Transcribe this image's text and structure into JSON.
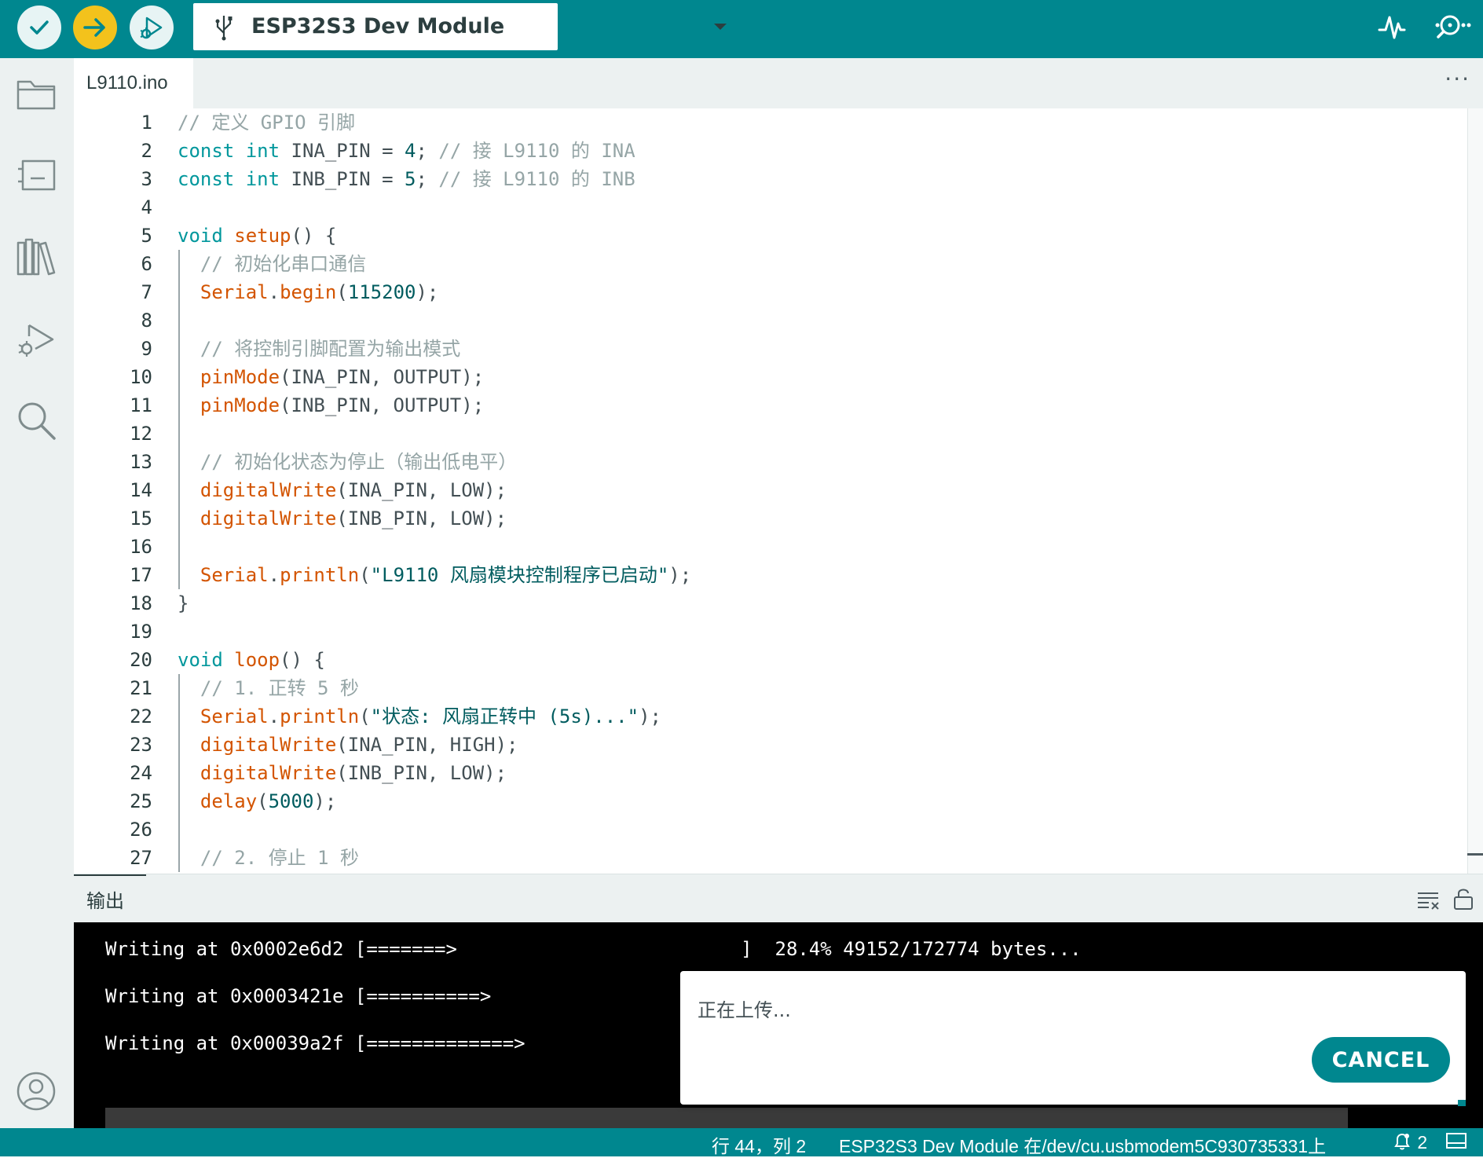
{
  "toolbar": {
    "verify_icon": "checkmark-icon",
    "upload_icon": "arrow-right-icon",
    "debug_icon": "debug-icon",
    "board_name": "ESP32S3 Dev Module",
    "serial_plotter_icon": "pulse-icon",
    "serial_monitor_icon": "magnifier-dots-icon"
  },
  "sidebar": {
    "items": [
      {
        "name": "sketchbook",
        "icon": "folder-icon"
      },
      {
        "name": "boards-manager",
        "icon": "board-icon"
      },
      {
        "name": "library-manager",
        "icon": "library-icon"
      },
      {
        "name": "debug",
        "icon": "debug-icon"
      },
      {
        "name": "search",
        "icon": "search-icon"
      },
      {
        "name": "profile",
        "icon": "user-icon"
      }
    ]
  },
  "tabs": [
    {
      "label": "L9110.ino",
      "active": true
    }
  ],
  "tab_more": "···",
  "editor": {
    "lines": [
      {
        "n": "1",
        "tokens": [
          {
            "t": "// 定义 GPIO 引脚",
            "c": "com"
          }
        ]
      },
      {
        "n": "2",
        "tokens": [
          {
            "t": "const",
            "c": "kw"
          },
          {
            "t": " ",
            "c": "plain"
          },
          {
            "t": "int",
            "c": "kw"
          },
          {
            "t": " INA_PIN = ",
            "c": "plain"
          },
          {
            "t": "4",
            "c": "num"
          },
          {
            "t": "; ",
            "c": "plain"
          },
          {
            "t": "// 接 L9110 的 INA",
            "c": "com"
          }
        ]
      },
      {
        "n": "3",
        "tokens": [
          {
            "t": "const",
            "c": "kw"
          },
          {
            "t": " ",
            "c": "plain"
          },
          {
            "t": "int",
            "c": "kw"
          },
          {
            "t": " INB_PIN = ",
            "c": "plain"
          },
          {
            "t": "5",
            "c": "num"
          },
          {
            "t": "; ",
            "c": "plain"
          },
          {
            "t": "// 接 L9110 的 INB",
            "c": "com"
          }
        ]
      },
      {
        "n": "4",
        "tokens": []
      },
      {
        "n": "5",
        "tokens": [
          {
            "t": "void",
            "c": "kw"
          },
          {
            "t": " ",
            "c": "plain"
          },
          {
            "t": "setup",
            "c": "fn"
          },
          {
            "t": "() {",
            "c": "plain"
          }
        ]
      },
      {
        "n": "6",
        "tokens": [
          {
            "t": "  ",
            "c": "plain"
          },
          {
            "t": "// 初始化串口通信",
            "c": "com"
          }
        ]
      },
      {
        "n": "7",
        "tokens": [
          {
            "t": "  ",
            "c": "plain"
          },
          {
            "t": "Serial",
            "c": "fn"
          },
          {
            "t": ".",
            "c": "plain"
          },
          {
            "t": "begin",
            "c": "fn"
          },
          {
            "t": "(",
            "c": "plain"
          },
          {
            "t": "115200",
            "c": "num"
          },
          {
            "t": ");",
            "c": "plain"
          }
        ]
      },
      {
        "n": "8",
        "tokens": []
      },
      {
        "n": "9",
        "tokens": [
          {
            "t": "  ",
            "c": "plain"
          },
          {
            "t": "// 将控制引脚配置为输出模式",
            "c": "com"
          }
        ]
      },
      {
        "n": "10",
        "tokens": [
          {
            "t": "  ",
            "c": "plain"
          },
          {
            "t": "pinMode",
            "c": "fn"
          },
          {
            "t": "(INA_PIN, OUTPUT);",
            "c": "plain"
          }
        ]
      },
      {
        "n": "11",
        "tokens": [
          {
            "t": "  ",
            "c": "plain"
          },
          {
            "t": "pinMode",
            "c": "fn"
          },
          {
            "t": "(INB_PIN, OUTPUT);",
            "c": "plain"
          }
        ]
      },
      {
        "n": "12",
        "tokens": []
      },
      {
        "n": "13",
        "tokens": [
          {
            "t": "  ",
            "c": "plain"
          },
          {
            "t": "// 初始化状态为停止（输出低电平）",
            "c": "com"
          }
        ]
      },
      {
        "n": "14",
        "tokens": [
          {
            "t": "  ",
            "c": "plain"
          },
          {
            "t": "digitalWrite",
            "c": "fn"
          },
          {
            "t": "(INA_PIN, LOW);",
            "c": "plain"
          }
        ]
      },
      {
        "n": "15",
        "tokens": [
          {
            "t": "  ",
            "c": "plain"
          },
          {
            "t": "digitalWrite",
            "c": "fn"
          },
          {
            "t": "(INB_PIN, LOW);",
            "c": "plain"
          }
        ]
      },
      {
        "n": "16",
        "tokens": []
      },
      {
        "n": "17",
        "tokens": [
          {
            "t": "  ",
            "c": "plain"
          },
          {
            "t": "Serial",
            "c": "fn"
          },
          {
            "t": ".",
            "c": "plain"
          },
          {
            "t": "println",
            "c": "fn"
          },
          {
            "t": "(",
            "c": "plain"
          },
          {
            "t": "\"L9110 风扇模块控制程序已启动\"",
            "c": "str"
          },
          {
            "t": ");",
            "c": "plain"
          }
        ]
      },
      {
        "n": "18",
        "tokens": [
          {
            "t": "}",
            "c": "plain"
          }
        ]
      },
      {
        "n": "19",
        "tokens": []
      },
      {
        "n": "20",
        "tokens": [
          {
            "t": "void",
            "c": "kw"
          },
          {
            "t": " ",
            "c": "plain"
          },
          {
            "t": "loop",
            "c": "fn"
          },
          {
            "t": "() {",
            "c": "plain"
          }
        ]
      },
      {
        "n": "21",
        "tokens": [
          {
            "t": "  ",
            "c": "plain"
          },
          {
            "t": "// 1. 正转 5 秒",
            "c": "com"
          }
        ]
      },
      {
        "n": "22",
        "tokens": [
          {
            "t": "  ",
            "c": "plain"
          },
          {
            "t": "Serial",
            "c": "fn"
          },
          {
            "t": ".",
            "c": "plain"
          },
          {
            "t": "println",
            "c": "fn"
          },
          {
            "t": "(",
            "c": "plain"
          },
          {
            "t": "\"状态: 风扇正转中 (5s)...\"",
            "c": "str"
          },
          {
            "t": ");",
            "c": "plain"
          }
        ]
      },
      {
        "n": "23",
        "tokens": [
          {
            "t": "  ",
            "c": "plain"
          },
          {
            "t": "digitalWrite",
            "c": "fn"
          },
          {
            "t": "(INA_PIN, HIGH);",
            "c": "plain"
          }
        ]
      },
      {
        "n": "24",
        "tokens": [
          {
            "t": "  ",
            "c": "plain"
          },
          {
            "t": "digitalWrite",
            "c": "fn"
          },
          {
            "t": "(INB_PIN, LOW);",
            "c": "plain"
          }
        ]
      },
      {
        "n": "25",
        "tokens": [
          {
            "t": "  ",
            "c": "plain"
          },
          {
            "t": "delay",
            "c": "fn"
          },
          {
            "t": "(",
            "c": "plain"
          },
          {
            "t": "5000",
            "c": "num"
          },
          {
            "t": ");",
            "c": "plain"
          }
        ]
      },
      {
        "n": "26",
        "tokens": []
      },
      {
        "n": "27",
        "tokens": [
          {
            "t": "  ",
            "c": "plain"
          },
          {
            "t": "// 2. 停止 1 秒",
            "c": "com"
          }
        ]
      }
    ]
  },
  "output": {
    "title": "输出",
    "clear_icon": "clear-output-icon",
    "lock_icon": "unlock-icon",
    "lines": [
      "Writing at 0x0002e6d2 [=======>                         ]  28.4% 49152/172774 bytes...",
      "Writing at 0x0003421e [==========>",
      "Writing at 0x00039a2f [=============>"
    ]
  },
  "dialog": {
    "message": "正在上传...",
    "cancel_label": "CANCEL"
  },
  "statusbar": {
    "position": "行 44，列 2",
    "board_port": "ESP32S3 Dev Module 在/dev/cu.usbmodem5C930735331上",
    "notification_count": "2",
    "notification_icon": "bell-icon",
    "panel_icon": "panel-toggle-icon"
  },
  "colors": {
    "accent": "#00878f",
    "upload_button": "#f3c21c",
    "keyword": "#00979c",
    "function": "#d35400",
    "comment": "#95a5a6"
  }
}
